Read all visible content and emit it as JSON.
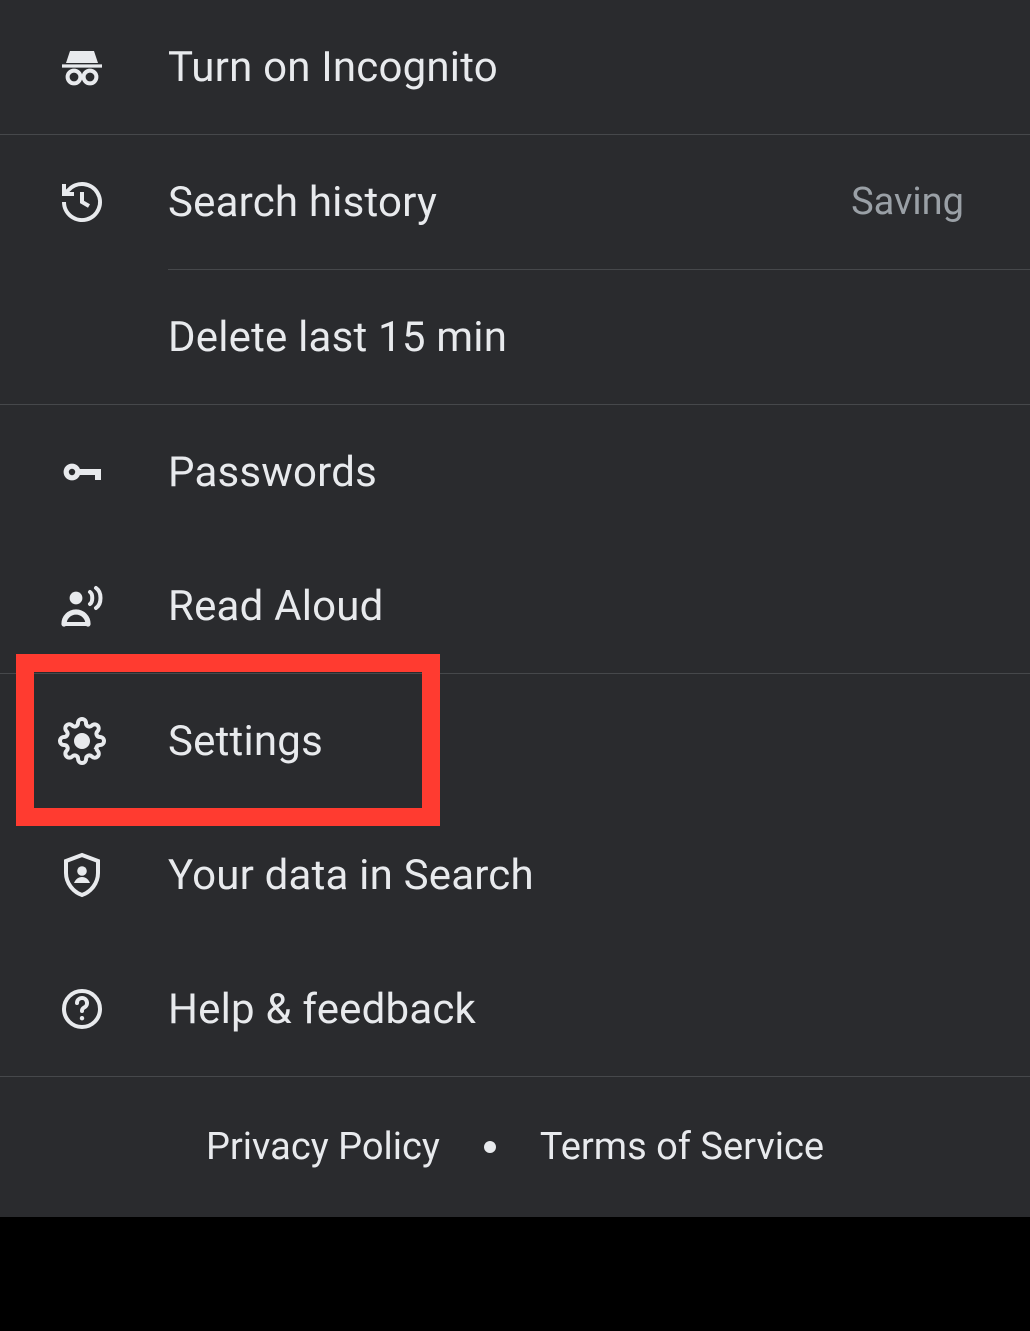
{
  "menu": {
    "incognito": {
      "label": "Turn on Incognito"
    },
    "search_history": {
      "label": "Search history",
      "status": "Saving"
    },
    "delete_15": {
      "label": "Delete last 15 min"
    },
    "passwords": {
      "label": "Passwords"
    },
    "read_aloud": {
      "label": "Read Aloud"
    },
    "settings": {
      "label": "Settings",
      "highlighted": true
    },
    "your_data": {
      "label": "Your data in Search"
    },
    "help": {
      "label": "Help & feedback"
    }
  },
  "footer": {
    "privacy": "Privacy Policy",
    "tos": "Terms of Service"
  },
  "colors": {
    "background": "#2a2b2e",
    "text": "#e8eaed",
    "muted": "#9aa0a6",
    "highlight": "#ff3b30"
  }
}
